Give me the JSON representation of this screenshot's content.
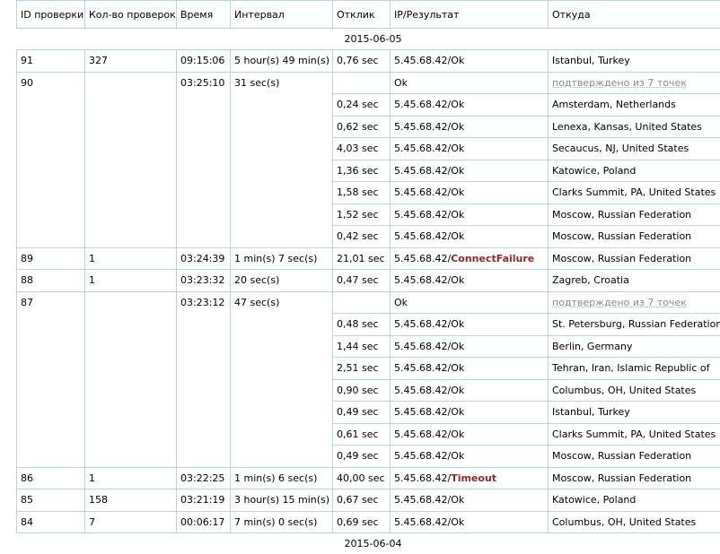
{
  "headers": [
    "ID проверки",
    "Кол-во проверок",
    "Время",
    "Интервал",
    "Отклик",
    "IP/Результат",
    "Откуда"
  ],
  "date_top": "2015-06-05",
  "date_bottom": "2015-06-04",
  "confirm_label": "подтверждено из 7 точек",
  "groups": [
    {
      "id": "91",
      "count": "327",
      "time": "09:15:06",
      "interval": "5 hour(s) 49 min(s)",
      "rows": [
        {
          "resp": "0,76 sec",
          "ip": "5.45.68.42/",
          "res": "Ok",
          "from": "Istanbul, Turkey"
        }
      ]
    },
    {
      "id": "90",
      "count": "",
      "time": "03:25:10",
      "interval": "31 sec(s)",
      "summary": "Ok",
      "rows": [
        {
          "resp": "0,24 sec",
          "ip": "5.45.68.42/",
          "res": "Ok",
          "from": "Amsterdam, Netherlands"
        },
        {
          "resp": "0,62 sec",
          "ip": "5.45.68.42/",
          "res": "Ok",
          "from": "Lenexa, Kansas, United States"
        },
        {
          "resp": "4,03 sec",
          "ip": "5.45.68.42/",
          "res": "Ok",
          "from": "Secaucus, NJ, United States"
        },
        {
          "resp": "1,36 sec",
          "ip": "5.45.68.42/",
          "res": "Ok",
          "from": "Katowice, Poland"
        },
        {
          "resp": "1,58 sec",
          "ip": "5.45.68.42/",
          "res": "Ok",
          "from": "Clarks Summit, PA, United States"
        },
        {
          "resp": "1,52 sec",
          "ip": "5.45.68.42/",
          "res": "Ok",
          "from": "Moscow, Russian Federation"
        },
        {
          "resp": "0,42 sec",
          "ip": "5.45.68.42/",
          "res": "Ok",
          "from": "Moscow, Russian Federation"
        }
      ]
    },
    {
      "id": "89",
      "count": "1",
      "time": "03:24:39",
      "interval": "1 min(s) 7 sec(s)",
      "rows": [
        {
          "resp": "21,01 sec",
          "ip": "5.45.68.42/",
          "res": "ConnectFailure",
          "error": true,
          "from": "Moscow, Russian Federation"
        }
      ]
    },
    {
      "id": "88",
      "count": "1",
      "time": "03:23:32",
      "interval": "20 sec(s)",
      "rows": [
        {
          "resp": "0,47 sec",
          "ip": "5.45.68.42/",
          "res": "Ok",
          "from": "Zagreb, Croatia"
        }
      ]
    },
    {
      "id": "87",
      "count": "",
      "time": "03:23:12",
      "interval": "47 sec(s)",
      "summary": "Ok",
      "rows": [
        {
          "resp": "0,48 sec",
          "ip": "5.45.68.42/",
          "res": "Ok",
          "from": "St. Petersburg, Russian Federation"
        },
        {
          "resp": "1,44 sec",
          "ip": "5.45.68.42/",
          "res": "Ok",
          "from": "Berlin, Germany"
        },
        {
          "resp": "2,51 sec",
          "ip": "5.45.68.42/",
          "res": "Ok",
          "from": "Tehran, Iran, Islamic Republic of"
        },
        {
          "resp": "0,90 sec",
          "ip": "5.45.68.42/",
          "res": "Ok",
          "from": "Columbus, OH, United States"
        },
        {
          "resp": "0,49 sec",
          "ip": "5.45.68.42/",
          "res": "Ok",
          "from": "Istanbul, Turkey"
        },
        {
          "resp": "0,61 sec",
          "ip": "5.45.68.42/",
          "res": "Ok",
          "from": "Clarks Summit, PA, United States"
        },
        {
          "resp": "0,49 sec",
          "ip": "5.45.68.42/",
          "res": "Ok",
          "from": "Moscow, Russian Federation"
        }
      ]
    },
    {
      "id": "86",
      "count": "1",
      "time": "03:22:25",
      "interval": "1 min(s) 6 sec(s)",
      "rows": [
        {
          "resp": "40,00 sec",
          "ip": "5.45.68.42/",
          "res": "Timeout",
          "error": true,
          "from": "Moscow, Russian Federation"
        }
      ]
    },
    {
      "id": "85",
      "count": "158",
      "time": "03:21:19",
      "interval": "3 hour(s) 15 min(s)",
      "rows": [
        {
          "resp": "0,67 sec",
          "ip": "5.45.68.42/",
          "res": "Ok",
          "from": "Katowice, Poland"
        }
      ]
    },
    {
      "id": "84",
      "count": "7",
      "time": "00:06:17",
      "interval": "7 min(s) 0 sec(s)",
      "rows": [
        {
          "resp": "0,69 sec",
          "ip": "5.45.68.42/",
          "res": "Ok",
          "from": "Columbus, OH, United States"
        }
      ]
    }
  ],
  "colors": {
    "border": "#bcd2e6",
    "error": "#8b2a2a",
    "muted": "#8a8a8a"
  }
}
